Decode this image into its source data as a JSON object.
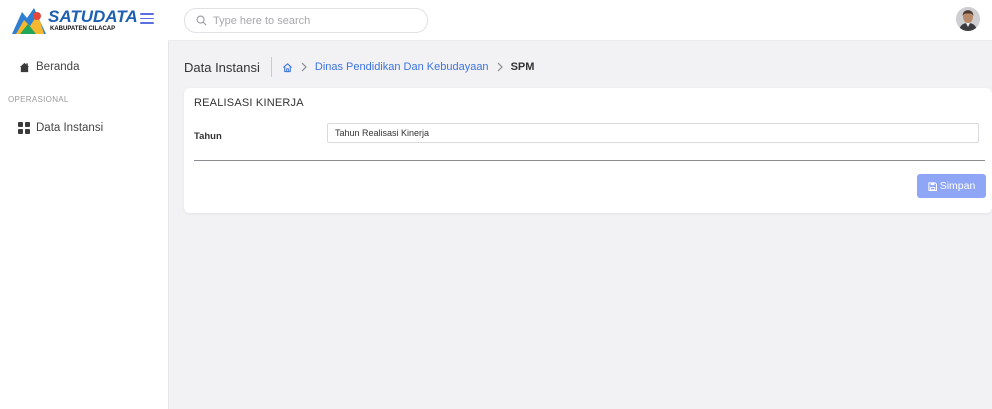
{
  "app": {
    "logo_text": "SATUDATA",
    "logo_subtext": "KABUPATEN CILACAP"
  },
  "sidebar": {
    "items": [
      {
        "label": "Beranda",
        "icon": "home-icon"
      },
      {
        "label": "Data Instansi",
        "icon": "grid-icon"
      }
    ],
    "section_label": "OPERASIONAL"
  },
  "header": {
    "search": {
      "placeholder": "Type here to search",
      "value": ""
    }
  },
  "breadcrumb": {
    "title": "Data Instansi",
    "link": "Dinas Pendidikan Dan Kebudayaan",
    "current": "SPM"
  },
  "card": {
    "title": "REALISASI KINERJA",
    "field_label": "Tahun",
    "field_value": "Tahun Realisasi Kinerja",
    "save_label": "Simpan"
  },
  "colors": {
    "accent": "#3d74e0",
    "button": "#8ea6f5",
    "background": "#f2f2f4"
  }
}
